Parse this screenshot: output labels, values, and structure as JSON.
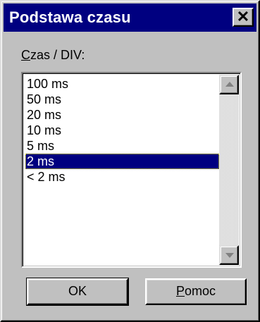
{
  "window": {
    "title": "Podstawa czasu",
    "close_symbol": "✕"
  },
  "time_per_div": {
    "label_accel": "C",
    "label_rest": "zas / DIV:",
    "options": [
      "100 ms",
      "50 ms",
      "20 ms",
      "10 ms",
      "5 ms",
      "2 ms",
      "< 2 ms"
    ],
    "selected": "2 ms"
  },
  "buttons": {
    "ok_label": "OK",
    "help_accel": "P",
    "help_rest": "omoc"
  },
  "icons": {
    "close": "close-icon",
    "scroll_up": "triangle-up-icon",
    "scroll_down": "triangle-down-icon"
  }
}
